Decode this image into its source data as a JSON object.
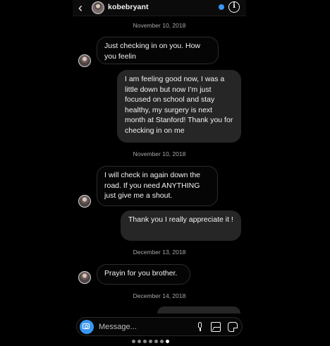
{
  "header": {
    "back_icon": "chevron-left-icon",
    "back_glyph": "‹",
    "username": "kobebryant",
    "verified_icon": "verified-badge-icon",
    "info_icon": "info-icon",
    "info_glyph": "i"
  },
  "timestamps": [
    "November 10, 2018",
    "November 10, 2018",
    "December 13, 2018",
    "December 14, 2018"
  ],
  "messages": [
    {
      "sender": "kobebryant",
      "direction": "incoming",
      "text": "Just checking in on you. How you feelin"
    },
    {
      "sender": "me",
      "direction": "outgoing",
      "text": "I am feeling good now, I was a little down but now I’m just focused on school and stay healthy, my surgery is next month at Stanford! Thank you for checking in on me"
    },
    {
      "sender": "kobebryant",
      "direction": "incoming",
      "text": "I will check in again down the road. If you need ANYTHING just give me a shout."
    },
    {
      "sender": "me",
      "direction": "outgoing",
      "text": "Thank you I really appreciate it !"
    },
    {
      "sender": "kobebryant",
      "direction": "incoming",
      "text": "Prayin for you brother."
    }
  ],
  "composer": {
    "placeholder": "Message...",
    "value": "",
    "camera_icon": "camera-icon",
    "mic_icon": "microphone-icon",
    "image_icon": "image-icon",
    "sticker_icon": "sticker-icon"
  },
  "pagination": {
    "total": 7,
    "active": 7
  },
  "colors": {
    "background": "#000000",
    "incoming_border": "#2b2b2b",
    "outgoing_bubble": "#262626",
    "accent": "#3897f0",
    "timestamp": "#a8a8a8"
  }
}
